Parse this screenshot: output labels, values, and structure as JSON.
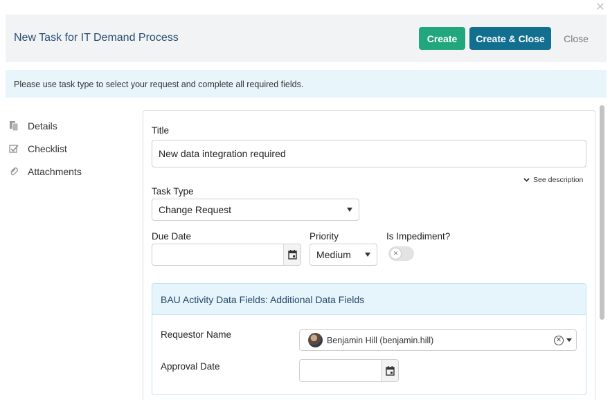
{
  "header": {
    "title": "New Task for IT Demand Process",
    "create_label": "Create",
    "create_close_label": "Create & Close",
    "close_label": "Close"
  },
  "banner": {
    "text": "Please use task type to select your request and complete all required fields."
  },
  "nav": {
    "items": [
      {
        "label": "Details",
        "icon": "document-icon"
      },
      {
        "label": "Checklist",
        "icon": "checklist-icon"
      },
      {
        "label": "Attachments",
        "icon": "paperclip-icon"
      }
    ]
  },
  "form": {
    "title_label": "Title",
    "title_value": "New data integration required",
    "see_description": "See description",
    "task_type_label": "Task Type",
    "task_type_value": "Change Request",
    "due_date_label": "Due Date",
    "due_date_value": "",
    "priority_label": "Priority",
    "priority_value": "Medium",
    "impediment_label": "Is Impediment?",
    "impediment_value": false
  },
  "section": {
    "title": "BAU Activity Data Fields: Additional Data Fields",
    "requestor_label": "Requestor Name",
    "requestor_value": "Benjamin Hill (benjamin.hill)",
    "approval_label": "Approval Date",
    "approval_value": ""
  },
  "colors": {
    "create": "#22a77c",
    "create_close": "#136f90",
    "title": "#2a4d72",
    "banner_bg": "#e8f5fb"
  }
}
